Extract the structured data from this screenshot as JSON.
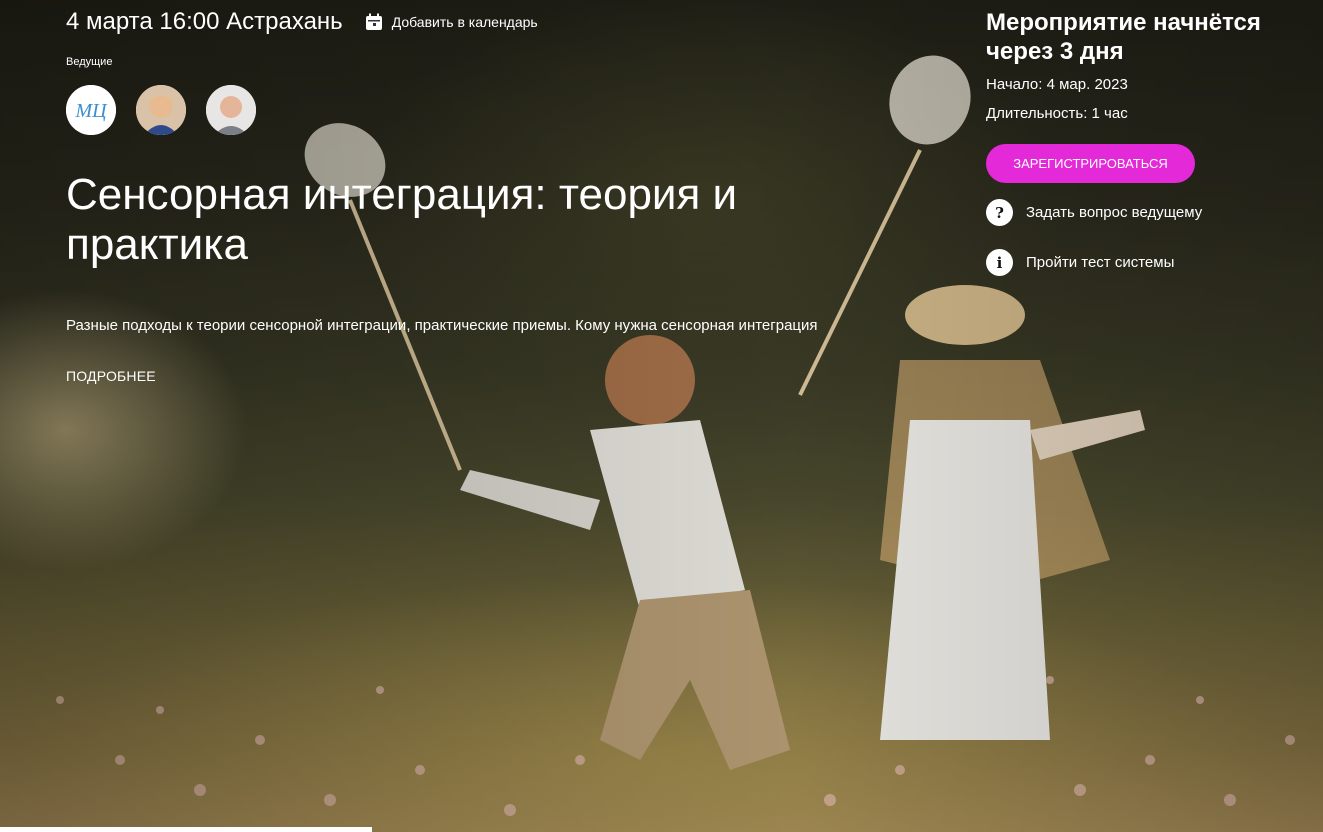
{
  "event": {
    "date_city": "4 марта 16:00 Астрахань",
    "calendar_label": "Добавить в календарь",
    "hosts_label": "Ведущие",
    "hosts": [
      {
        "avatar_text": "МЦ"
      },
      {
        "avatar_text": ""
      },
      {
        "avatar_text": ""
      }
    ],
    "title": "Сенсорная интеграция: теория и практика",
    "description": "Разные подходы к теории сенсорной интеграции, практические приемы. Кому нужна сенсорная интеграция",
    "more_label": "ПОДРОБНЕЕ"
  },
  "sidebar": {
    "starts_in": "Мероприятие начнётся через 3 дня",
    "start": "Начало: 4 мар. 2023",
    "duration": "Длительность: 1 час",
    "register_label": "ЗАРЕГИСТРИРОВАТЬСЯ",
    "ask_label": "Задать вопрос ведущему",
    "test_label": "Пройти тест системы"
  },
  "colors": {
    "accent": "#e429d9"
  },
  "icons": [
    "calendar-icon",
    "question-icon",
    "info-icon"
  ]
}
